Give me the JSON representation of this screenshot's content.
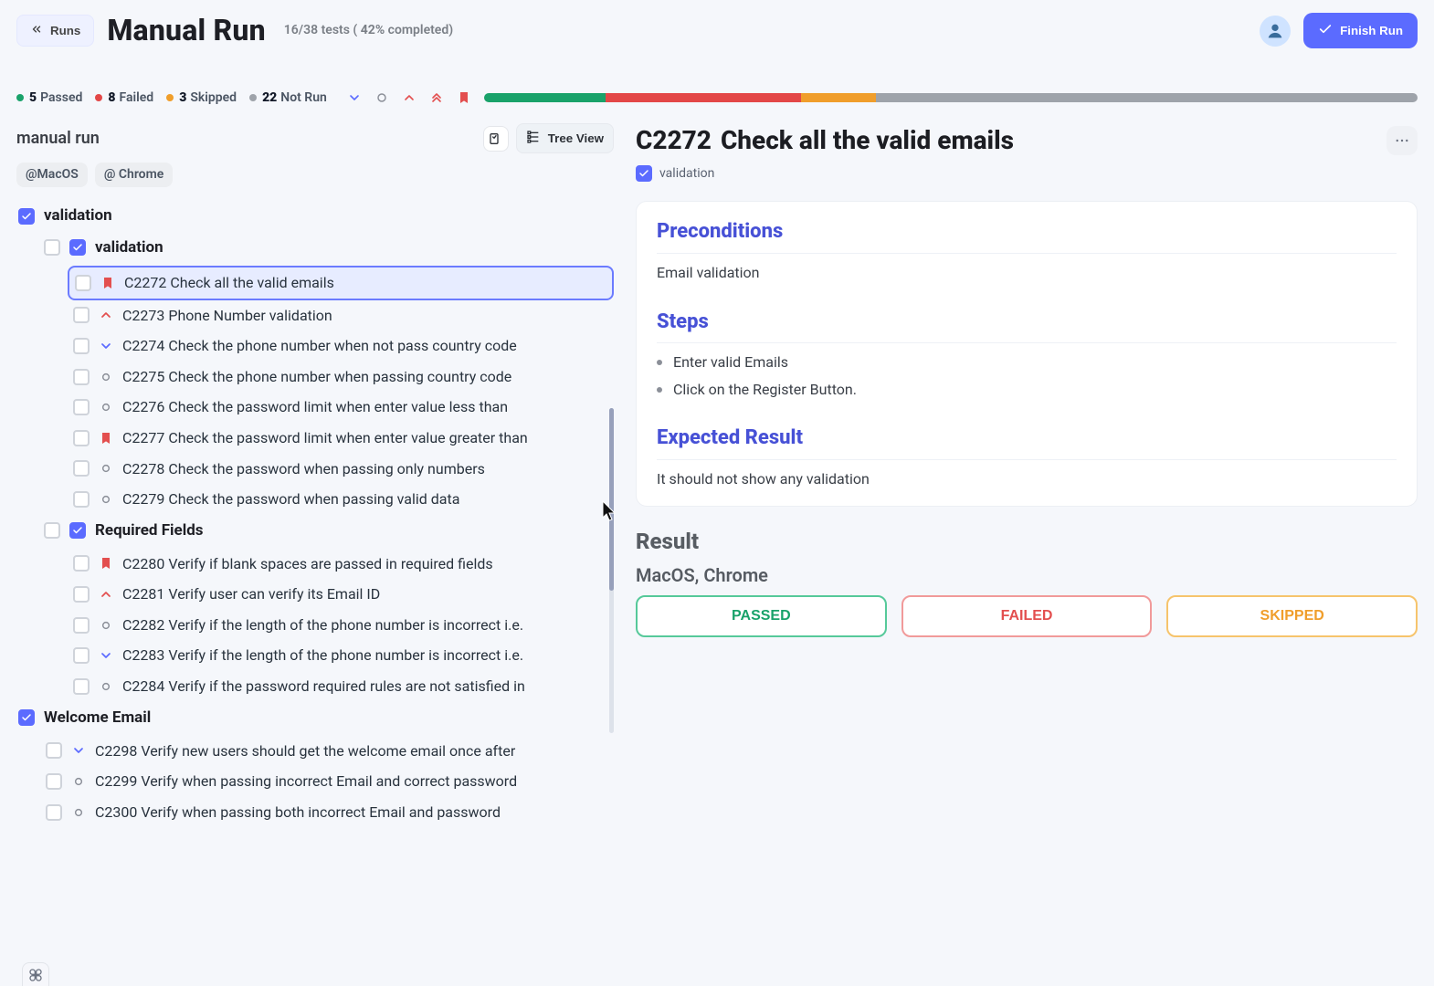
{
  "header": {
    "back_label": "Runs",
    "title": "Manual Run",
    "tests_completed": "16/38",
    "tests_word": "tests",
    "percent": "42%",
    "completed_word": "completed",
    "finish_label": "Finish Run"
  },
  "summary": {
    "passed": {
      "count": "5",
      "label": "Passed"
    },
    "failed": {
      "count": "8",
      "label": "Failed"
    },
    "skipped": {
      "count": "3",
      "label": "Skipped"
    },
    "notrun": {
      "count": "22",
      "label": "Not Run"
    },
    "progress": {
      "g": 13,
      "r": 21,
      "a": 8,
      "gr": 58
    }
  },
  "left": {
    "title": "manual run",
    "tree_view_label": "Tree View",
    "chips": [
      "@MacOS",
      "@ Chrome"
    ],
    "sections": [
      {
        "label": "validation",
        "checked": true,
        "children": [
          {
            "label": "validation",
            "checked": true,
            "items": [
              {
                "id": "C2272",
                "label": "Check all the valid emails",
                "status": "bookmark-red",
                "selected": true
              },
              {
                "id": "C2273",
                "label": "Phone Number validation",
                "status": "chev-up-red"
              },
              {
                "id": "C2274",
                "label": "Check the phone number when not pass country code",
                "status": "chev-down-blue"
              },
              {
                "id": "C2275",
                "label": "Check the phone number when passing country code",
                "status": "circle"
              },
              {
                "id": "C2276",
                "label": "Check the password limit when enter value less than",
                "status": "circle"
              },
              {
                "id": "C2277",
                "label": "Check the password limit when enter value greater than",
                "status": "bookmark-red"
              },
              {
                "id": "C2278",
                "label": "Check the password when passing only numbers",
                "status": "circle"
              },
              {
                "id": "C2279",
                "label": "Check the password when passing valid data",
                "status": "circle"
              }
            ]
          },
          {
            "label": "Required Fields",
            "checked": true,
            "items": [
              {
                "id": "C2280",
                "label": "Verify if blank spaces are passed in required fields",
                "status": "bookmark-red"
              },
              {
                "id": "C2281",
                "label": "Verify user can verify its Email ID",
                "status": "chev-up-red"
              },
              {
                "id": "C2282",
                "label": "Verify if the length of the phone number is incorrect i.e.",
                "status": "circle"
              },
              {
                "id": "C2283",
                "label": "Verify if the length of the phone number is incorrect i.e.",
                "status": "chev-down-blue"
              },
              {
                "id": "C2284",
                "label": "Verify if the password required rules are not satisfied in",
                "status": "circle"
              }
            ]
          }
        ]
      },
      {
        "label": "Welcome Email",
        "checked": true,
        "items": [
          {
            "id": "C2298",
            "label": "Verify new users should get the welcome email once after",
            "status": "chev-down-blue"
          },
          {
            "id": "C2299",
            "label": "Verify when passing incorrect Email and correct password",
            "status": "circle"
          },
          {
            "id": "C2300",
            "label": "Verify when passing both incorrect Email and password",
            "status": "circle"
          }
        ]
      }
    ]
  },
  "right": {
    "case_code": "C2272",
    "case_title": "Check all the valid emails",
    "crumb_label": "validation",
    "preconditions_heading": "Preconditions",
    "preconditions_text": "Email validation",
    "steps_heading": "Steps",
    "steps": [
      "Enter valid Emails",
      "Click on the Register Button."
    ],
    "expected_heading": "Expected Result",
    "expected_text": "It should not show any validation",
    "result_heading": "Result",
    "env": "MacOS, Chrome",
    "buttons": {
      "passed": "PASSED",
      "failed": "FAILED",
      "skipped": "SKIPPED"
    }
  }
}
